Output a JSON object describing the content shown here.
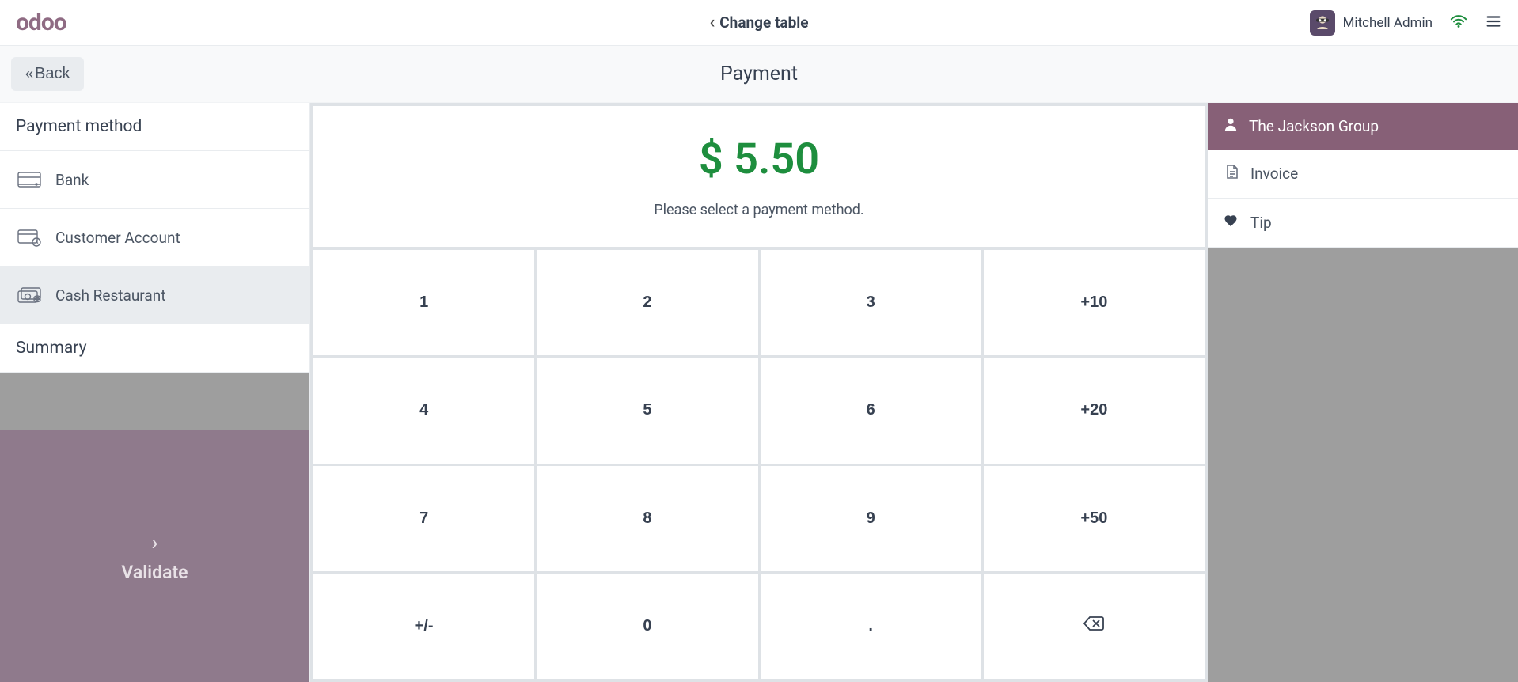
{
  "header": {
    "logo_text": "odoo",
    "change_table_label": "Change table",
    "username": "Mitchell Admin"
  },
  "secondbar": {
    "back_label": "Back",
    "page_title": "Payment"
  },
  "left": {
    "payment_method_header": "Payment method",
    "methods": [
      {
        "label": "Bank"
      },
      {
        "label": "Customer Account"
      },
      {
        "label": "Cash Restaurant"
      }
    ],
    "summary_header": "Summary",
    "validate_label": "Validate"
  },
  "center": {
    "amount_display": "$ 5.50",
    "hint": "Please select a payment method.",
    "keys": {
      "k1": "1",
      "k2": "2",
      "k3": "3",
      "k_plus10": "+10",
      "k4": "4",
      "k5": "5",
      "k6": "6",
      "k_plus20": "+20",
      "k7": "7",
      "k8": "8",
      "k9": "9",
      "k_plus50": "+50",
      "k_pm": "+/-",
      "k0": "0",
      "k_dot": "."
    }
  },
  "right": {
    "customer_name": "The Jackson Group",
    "invoice_label": "Invoice",
    "tip_label": "Tip"
  }
}
